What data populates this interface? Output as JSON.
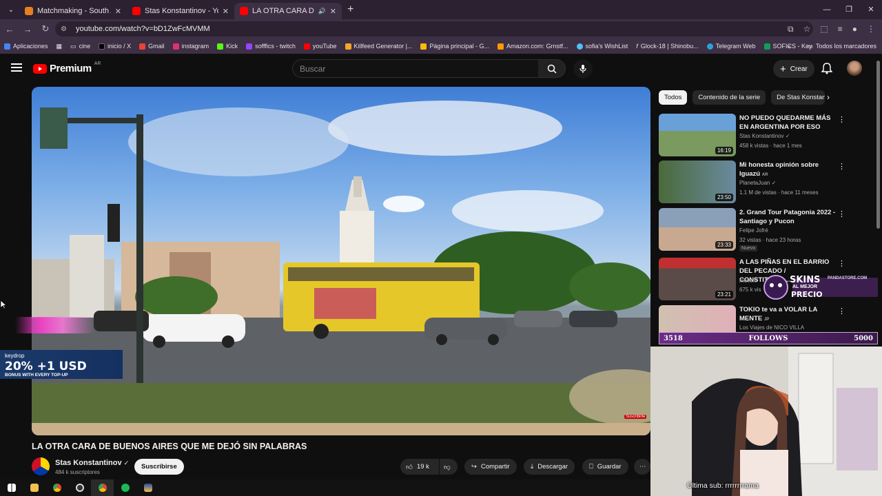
{
  "browser": {
    "tabs": [
      {
        "title": "Matchmaking - South America",
        "color": "#e67e22"
      },
      {
        "title": "Stas Konstantinov - YouTube",
        "color": "#ff0000"
      },
      {
        "title": "LA OTRA CARA DE BUENOS",
        "color": "#ff0000",
        "active": true
      }
    ],
    "url": "youtube.com/watch?v=bD1ZwFcMVMM",
    "bookmarks": [
      {
        "label": "Aplicaciones",
        "color": "#4285f4"
      },
      {
        "label": "cine",
        "color": "#888888"
      },
      {
        "label": "inicio / X",
        "color": "#000000"
      },
      {
        "label": "Gmail",
        "color": "#ea4335"
      },
      {
        "label": "instagram",
        "color": "#e1306c"
      },
      {
        "label": "Kick",
        "color": "#53fc18"
      },
      {
        "label": "sofffics - twitch",
        "color": "#9146ff"
      },
      {
        "label": "youTube",
        "color": "#ff0000"
      },
      {
        "label": "Killfeed Generator |...",
        "color": "#f5a623"
      },
      {
        "label": "Página principal - G...",
        "color": "#fbbc05"
      },
      {
        "label": "Amazon.com: Grnstf...",
        "color": "#ff9900"
      },
      {
        "label": "sofia's WishList",
        "color": "#4fc3f7"
      },
      {
        "label": "Glock-18 | Shinobu...",
        "color": "#e0e0e0"
      },
      {
        "label": "Telegram Web",
        "color": "#2aa1da"
      },
      {
        "label": "SOFICS - Key",
        "color": "#0f9d58"
      }
    ],
    "all_bookmarks": "Todos los marcadores"
  },
  "youtube": {
    "logo_text": "Premium",
    "region": "AR",
    "search_placeholder": "Buscar",
    "create_label": "Crear"
  },
  "video": {
    "title": "LA OTRA CARA DE BUENOS AIRES QUE ME DEJÓ SIN PALABRAS",
    "channel": "Stas Konstantinov",
    "subscribers": "484 k suscriptores",
    "subscribe_label": "Suscribirse",
    "likes": "19 k",
    "share_label": "Compartir",
    "download_label": "Descargar",
    "save_label": "Guardar",
    "overlay_subscribe": "Suscribirte"
  },
  "sidebar": {
    "chips": [
      "Todos",
      "Contenido de la serie",
      "De Stas Konstan"
    ],
    "recommendations": [
      {
        "title": "NO PUEDO QUEDARME MÁS EN ARGENTINA POR ESO",
        "channel": "Stas Konstantinov",
        "meta": "458 k vistas · hace 1 mes",
        "duration": "16:19",
        "badge": ""
      },
      {
        "title": "Mi honesta opinión sobre Iguazú",
        "channel": "PlanetaJuan",
        "meta": "1.1 M de vistas · hace 11 meses",
        "duration": "23:50",
        "badge": ""
      },
      {
        "title": "2. Grand Tour Patagonia 2022 - Santiago y Pucon",
        "channel": "Felipe Jofré",
        "meta": "32 vistas · hace 23 horas",
        "duration": "23:33",
        "badge": "Nuevo"
      },
      {
        "title": "A LAS PIÑAS EN EL BARRIO DEL PECADO / CONSTITUCIO...",
        "channel": "movimi",
        "meta": "675 k vis",
        "duration": "23:21",
        "badge": ""
      },
      {
        "title": "TOKIO te va a VOLAR LA MENTE",
        "channel": "Los Viajes de NICO VILLA",
        "meta": "",
        "duration": "",
        "badge": ""
      }
    ]
  },
  "stream_overlay": {
    "follows_current": "3518",
    "follows_label": "FOLLOWS",
    "follows_goal": "5000",
    "skins_line1": "SKINS",
    "skins_line2": "AL MEJOR",
    "skins_line3": "PRECIO",
    "skins_site": "PANDASTORE.COM",
    "keydrop_brand": "keydrop",
    "keydrop_offer": "20% +1 USD",
    "keydrop_sub": "BONUS WITH EVERY TOP-UP",
    "last_sub": "Última sub: rrrrrrrrama"
  }
}
